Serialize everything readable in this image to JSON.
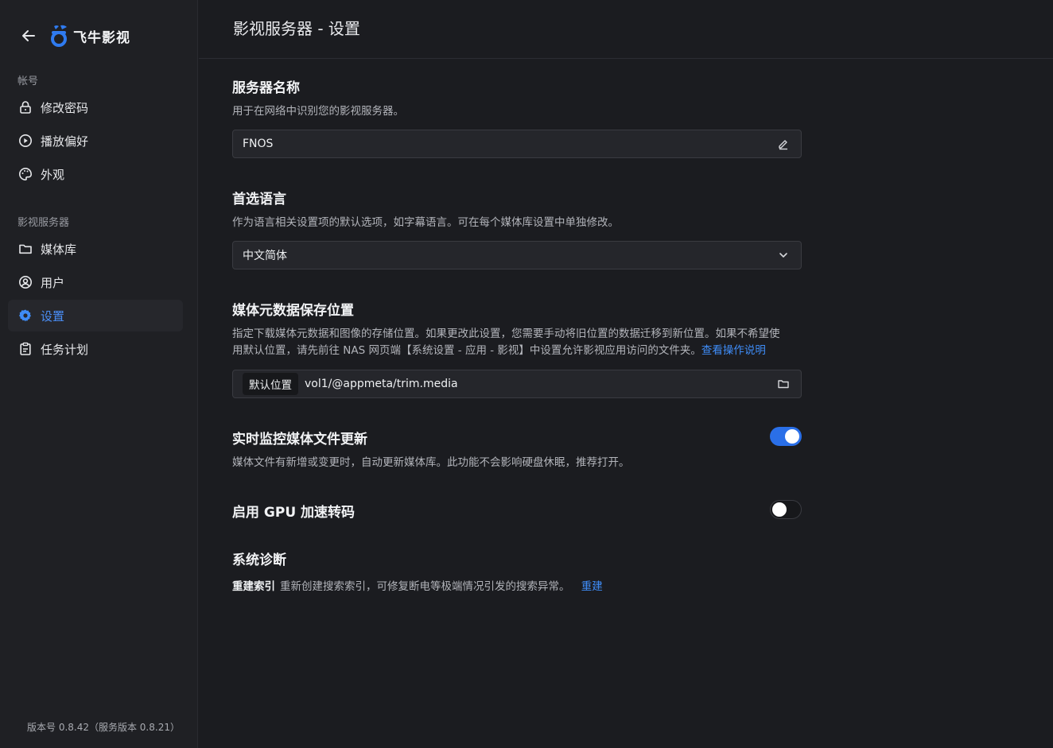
{
  "brand": {
    "name": "飞牛影视",
    "accent": "#2f7bf0"
  },
  "sidebar": {
    "sections": [
      {
        "label": "帐号",
        "items": [
          {
            "label": "修改密码",
            "icon": "lock-icon"
          },
          {
            "label": "播放偏好",
            "icon": "play-circle-icon"
          },
          {
            "label": "外观",
            "icon": "palette-icon"
          }
        ]
      },
      {
        "label": "影视服务器",
        "items": [
          {
            "label": "媒体库",
            "icon": "folder-icon"
          },
          {
            "label": "用户",
            "icon": "user-circle-icon"
          },
          {
            "label": "设置",
            "icon": "gear-icon",
            "active": true
          },
          {
            "label": "任务计划",
            "icon": "clipboard-icon"
          }
        ]
      }
    ],
    "version": "版本号 0.8.42（服务版本 0.8.21）"
  },
  "header": {
    "title": "影视服务器 - 设置"
  },
  "server_name": {
    "title": "服务器名称",
    "desc": "用于在网络中识别您的影视服务器。",
    "value": "FNOS"
  },
  "language": {
    "title": "首选语言",
    "desc": "作为语言相关设置项的默认选项，如字幕语言。可在每个媒体库设置中单独修改。",
    "selected": "中文简体"
  },
  "metadata": {
    "title": "媒体元数据保存位置",
    "desc_line1": "指定下载媒体元数据和图像的存储位置。如果更改此设置，您需要手动将旧位置的数据迁移到新位置。如果不希望使",
    "desc_line2": "用默认位置，请先前往 NAS 网页端【系统设置 - 应用 - 影视】中设置允许影视应用访问的文件夹。",
    "link": "查看操作说明",
    "tag": "默认位置",
    "path": "vol1/@appmeta/trim.media"
  },
  "realtime_monitor": {
    "title": "实时监控媒体文件更新",
    "desc": "媒体文件有新增或变更时，自动更新媒体库。此功能不会影响硬盘休眠，推荐打开。",
    "enabled": true
  },
  "gpu": {
    "title": "启用 GPU 加速转码",
    "enabled": false
  },
  "diagnostics": {
    "title": "系统诊断",
    "item_label": "重建索引",
    "item_desc": "重新创建搜索索引，可修复断电等极端情况引发的搜索异常。",
    "action": "重建"
  }
}
